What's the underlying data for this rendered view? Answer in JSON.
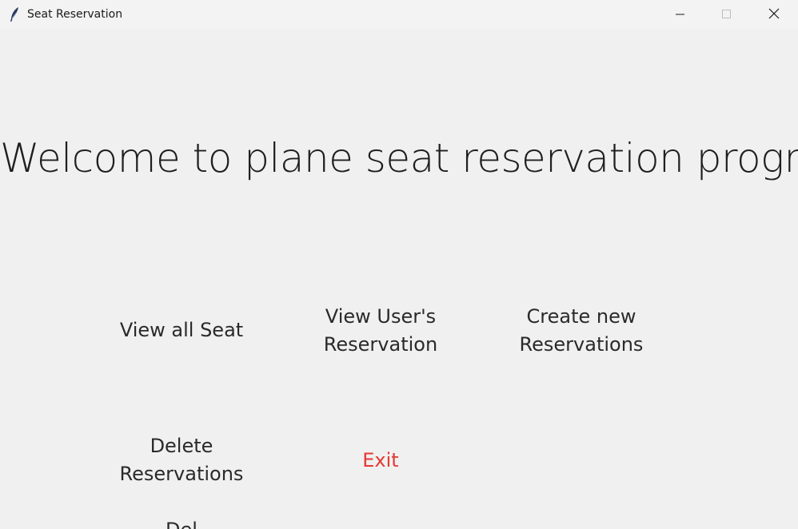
{
  "window": {
    "title": "Seat Reservation",
    "controls": {
      "minimize_icon": "minimize-icon",
      "maximize_icon": "maximize-icon",
      "close_icon": "close-icon"
    },
    "app_icon": "feather-icon"
  },
  "main": {
    "heading": "Welcome to plane seat reservation program",
    "buttons": {
      "view_all_seat": {
        "line1": "View all Seat"
      },
      "view_user_reservation": {
        "line1": "View User's",
        "line2": "Reservation"
      },
      "create_new_reservations": {
        "line1": "Create new",
        "line2": "Reservations"
      },
      "delete_reservations": {
        "line1": "Delete",
        "line2": "Reservations"
      },
      "exit": {
        "line1": "Exit"
      },
      "partial_button": {
        "line1": "Del"
      }
    }
  },
  "colors": {
    "background": "#f0f0f0",
    "text": "#2a2a2a",
    "exit_text": "#e53935"
  }
}
